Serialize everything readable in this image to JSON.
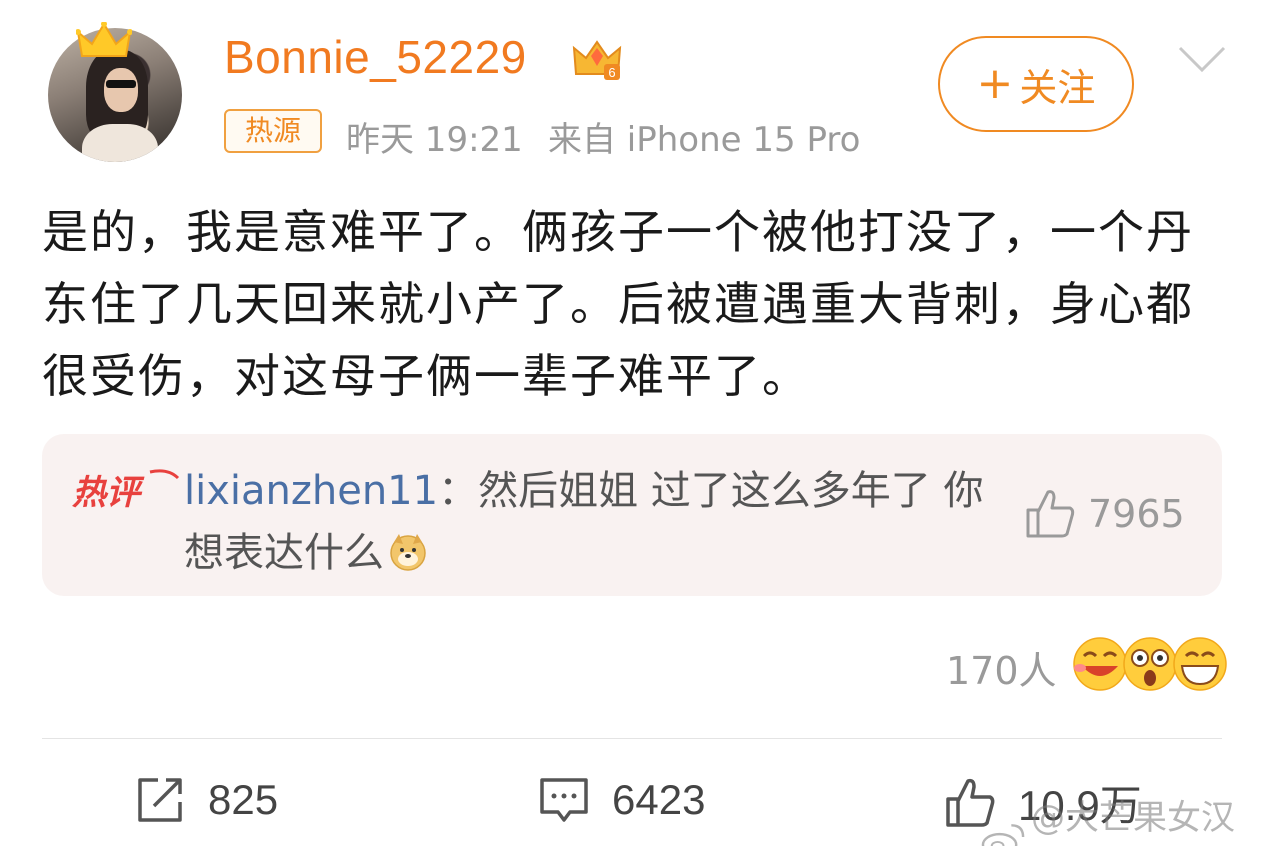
{
  "post": {
    "username": "Bonnie_52229",
    "vip_level": "6",
    "hot_badge": "热源",
    "time": "昨天 19:21",
    "source": "来自 iPhone 15 Pro",
    "follow_label": "关注",
    "follow_plus": "+",
    "text": "是的，我是意难平了。俩孩子一个被他打没了，一个丹东住了几天回来就小产了。后被遭遇重大背刺，身心都很受伤，对这母子俩一辈子难平了。"
  },
  "hot_comment": {
    "tag": "热评",
    "user": "lixianzhen11",
    "separator": "：",
    "text": "然后姐姐 过了这么多年了 你想表达什么",
    "likes": "7965"
  },
  "reactions": {
    "count": "170人"
  },
  "actions": {
    "repost": "825",
    "comment": "6423",
    "like": "10.9万"
  },
  "watermark": "@大芒果女汉子",
  "colors": {
    "accent_orange": "#f17a20",
    "link_blue": "#4a6fa5",
    "hot_red": "#e8413e",
    "card_bg": "#f9f2f1"
  }
}
